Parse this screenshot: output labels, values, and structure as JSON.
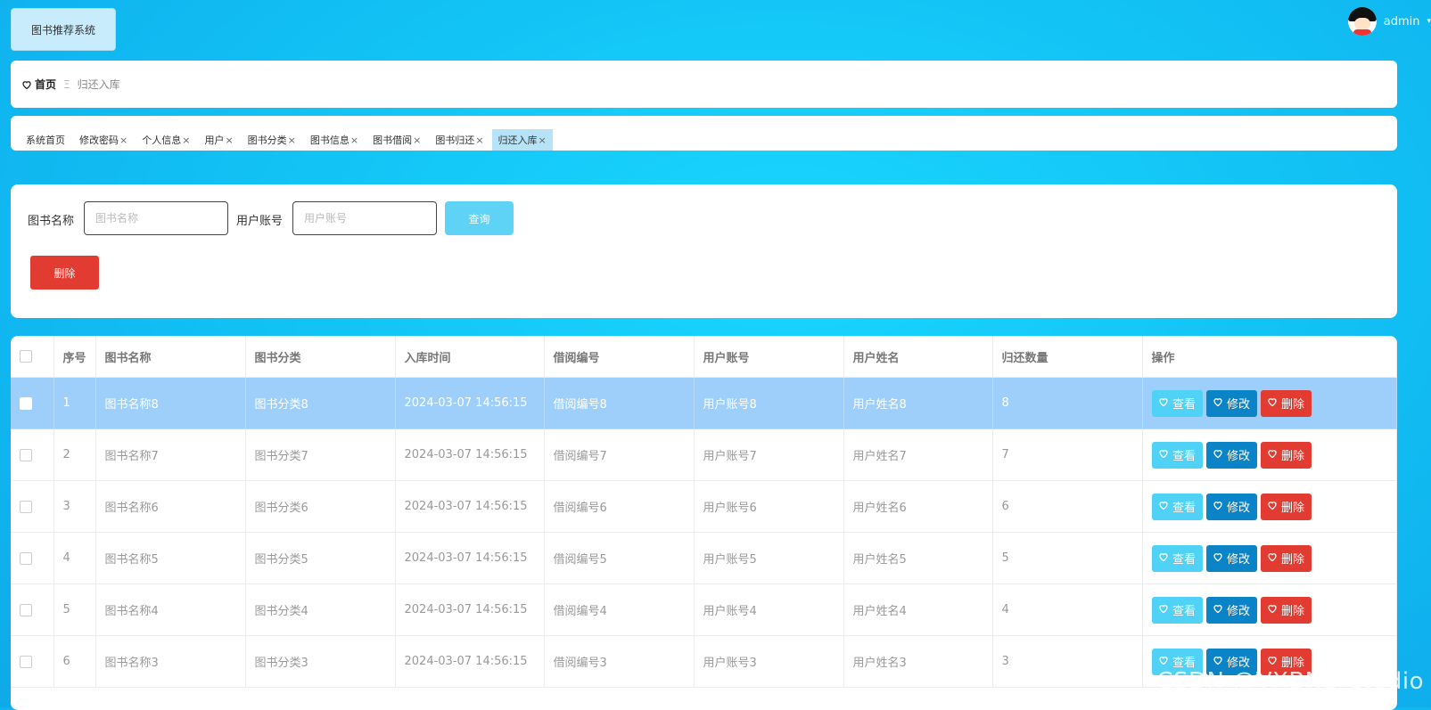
{
  "header": {
    "system_title": "图书推荐系统",
    "user_name": "admin"
  },
  "breadcrumb": {
    "home": "首页",
    "current": "归还入库"
  },
  "tabs": [
    {
      "label": "系统首页",
      "closable": false
    },
    {
      "label": "修改密码",
      "closable": true
    },
    {
      "label": "个人信息",
      "closable": true
    },
    {
      "label": "用户",
      "closable": true
    },
    {
      "label": "图书分类",
      "closable": true
    },
    {
      "label": "图书信息",
      "closable": true
    },
    {
      "label": "图书借阅",
      "closable": true
    },
    {
      "label": "图书归还",
      "closable": true
    },
    {
      "label": "归还入库",
      "closable": true,
      "active": true
    }
  ],
  "search": {
    "book_name_label": "图书名称",
    "book_name_placeholder": "图书名称",
    "book_name_value": "",
    "user_account_label": "用户账号",
    "user_account_placeholder": "用户账号",
    "user_account_value": "",
    "query_button": "查询",
    "batch_delete_button": "删除"
  },
  "table": {
    "headers": [
      "序号",
      "图书名称",
      "图书分类",
      "入库时间",
      "借阅编号",
      "用户账号",
      "用户姓名",
      "归还数量",
      "操作"
    ],
    "rows": [
      {
        "no": "1",
        "book_name": "图书名称8",
        "category": "图书分类8",
        "time": "2024-03-07 14:56:15",
        "borrow_no": "借阅编号8",
        "account": "用户账号8",
        "user_name": "用户姓名8",
        "qty": "8",
        "highlighted": true
      },
      {
        "no": "2",
        "book_name": "图书名称7",
        "category": "图书分类7",
        "time": "2024-03-07 14:56:15",
        "borrow_no": "借阅编号7",
        "account": "用户账号7",
        "user_name": "用户姓名7",
        "qty": "7"
      },
      {
        "no": "3",
        "book_name": "图书名称6",
        "category": "图书分类6",
        "time": "2024-03-07 14:56:15",
        "borrow_no": "借阅编号6",
        "account": "用户账号6",
        "user_name": "用户姓名6",
        "qty": "6"
      },
      {
        "no": "4",
        "book_name": "图书名称5",
        "category": "图书分类5",
        "time": "2024-03-07 14:56:15",
        "borrow_no": "借阅编号5",
        "account": "用户账号5",
        "user_name": "用户姓名5",
        "qty": "5"
      },
      {
        "no": "5",
        "book_name": "图书名称4",
        "category": "图书分类4",
        "time": "2024-03-07 14:56:15",
        "borrow_no": "借阅编号4",
        "account": "用户账号4",
        "user_name": "用户姓名4",
        "qty": "4"
      },
      {
        "no": "6",
        "book_name": "图书名称3",
        "category": "图书分类3",
        "time": "2024-03-07 14:56:15",
        "borrow_no": "借阅编号3",
        "account": "用户账号3",
        "user_name": "用户姓名3",
        "qty": "3"
      }
    ],
    "actions": {
      "view": "查看",
      "edit": "修改",
      "delete": "删除"
    }
  },
  "watermark": "CSDN @VXBNS_studio",
  "icons": {
    "home": "heart-icon",
    "action": "heart-icon"
  },
  "colors": {
    "view": "#4fd2f5",
    "edit": "#0a84c6",
    "delete": "#e23b32",
    "highlight_row": "#9ecffb"
  }
}
